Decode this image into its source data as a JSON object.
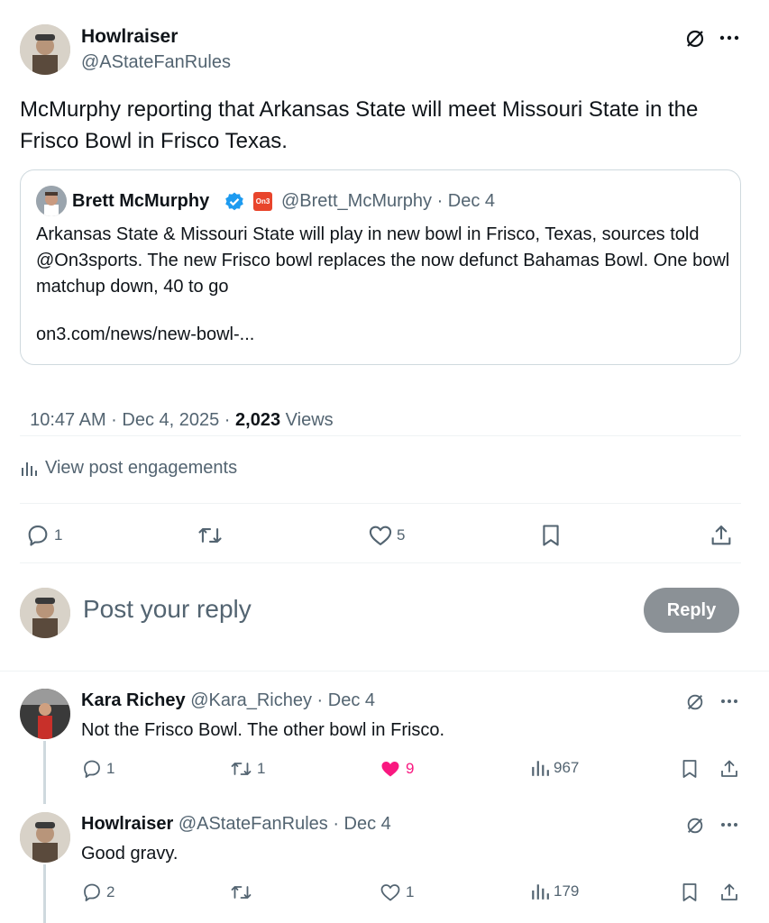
{
  "main_post": {
    "author_name": "Howlraiser",
    "author_handle": "@AStateFanRules",
    "text": "McMurphy reporting that Arkansas State will meet Missouri State in the Frisco Bowl in Frisco Texas.",
    "quote": {
      "author_name": "Brett McMurphy",
      "badge_text": "On3",
      "handle_date": "@Brett_McMurphy · Dec 4",
      "text": "Arkansas State & Missouri State will play in new bowl in Frisco, Texas, sources told @On3sports. The new Frisco bowl replaces the now defunct Bahamas Bowl. One bowl matchup down, 40 to go",
      "link": "on3.com/news/new-bowl-..."
    },
    "timestamp": "10:47 AM · Dec 4, 2025 · ",
    "views_count": "2,023",
    "views_label": " Views",
    "engagements_label": "View post engagements",
    "actions": {
      "replies": "1",
      "likes": "5"
    }
  },
  "compose": {
    "placeholder": "Post your reply",
    "reply_button": "Reply"
  },
  "replies": [
    {
      "author_name": "Kara Richey",
      "handle_date": "@Kara_Richey · Dec 4",
      "text": "Not the Frisco Bowl. The other bowl in Frisco.",
      "replies": "1",
      "reposts": "1",
      "likes": "9",
      "views": "967"
    },
    {
      "author_name": "Howlraiser",
      "handle_date": "@AStateFanRules · Dec 4",
      "text": "Good gravy.",
      "replies": "2",
      "likes": "1",
      "views": "179"
    }
  ],
  "colors": {
    "like_active": "#f91880",
    "verified": "#1d9bf0",
    "reply_button_bg": "#8b9196"
  }
}
